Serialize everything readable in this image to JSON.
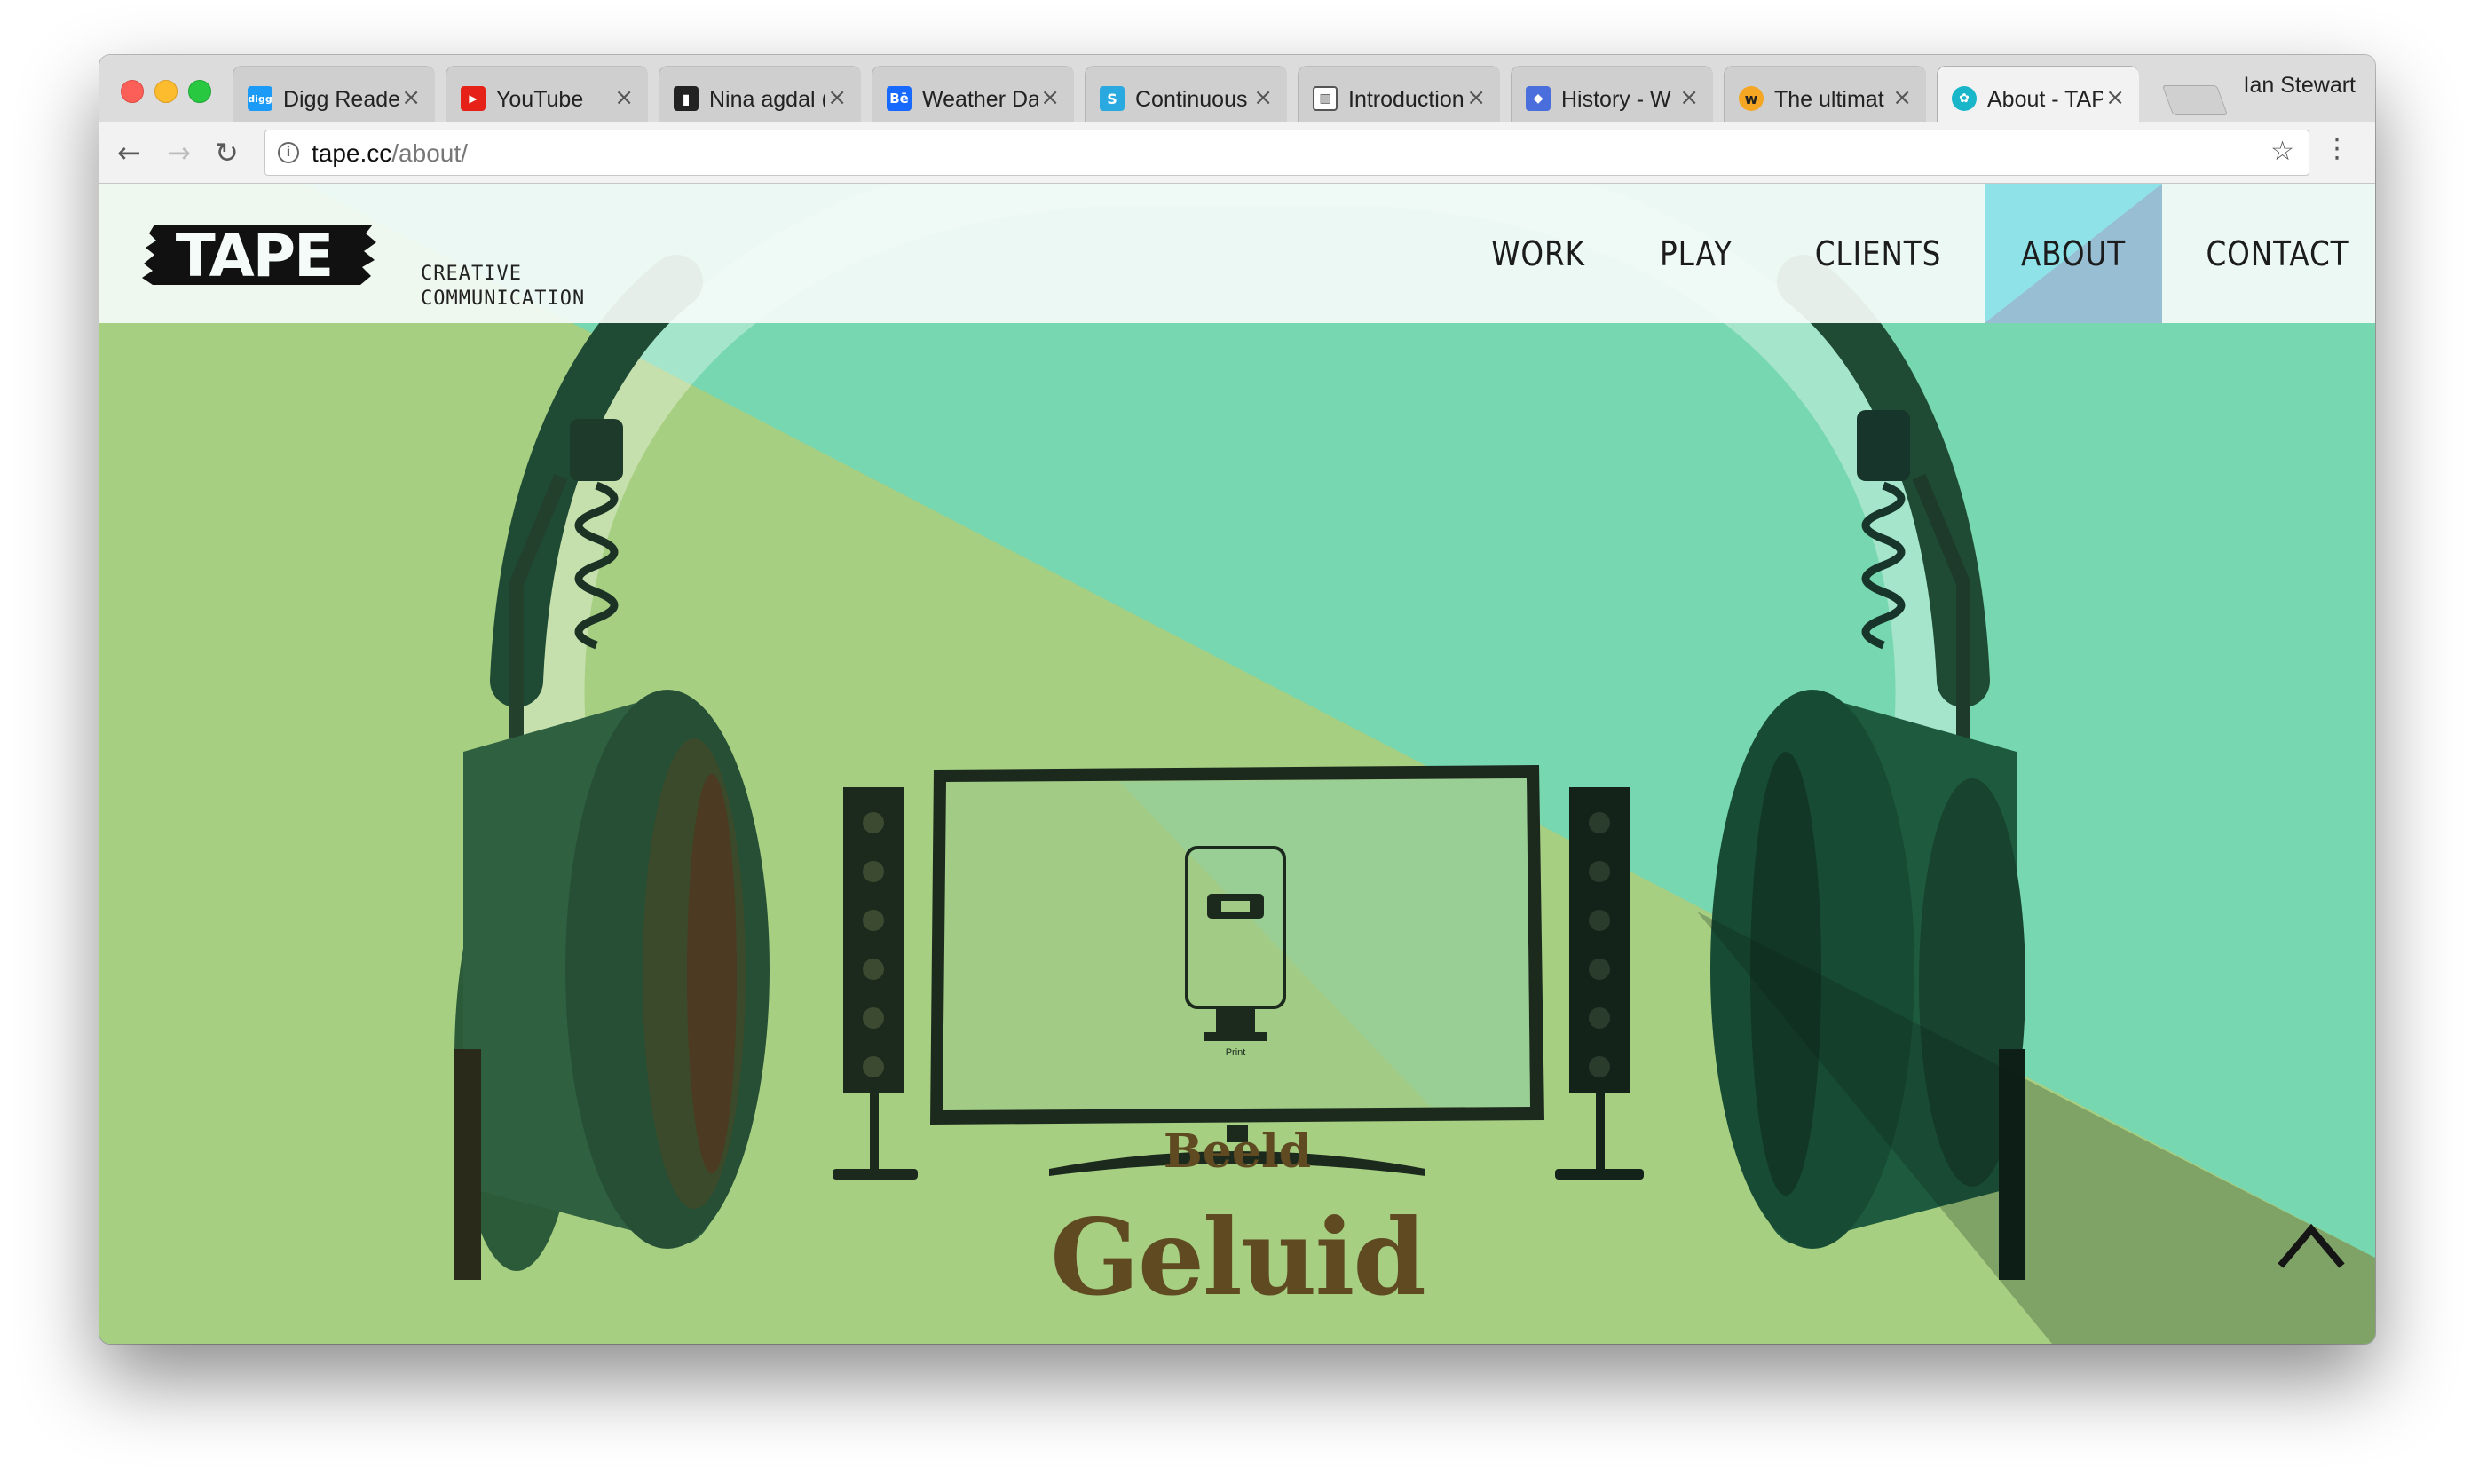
{
  "browser": {
    "tabs": [
      {
        "title": "Digg Reader",
        "favicon": "digg-icon",
        "color": "#1b9af7"
      },
      {
        "title": "YouTube",
        "favicon": "youtube-icon",
        "color": "#e62117"
      },
      {
        "title": "Nina agdal (",
        "favicon": "page-icon",
        "color": "#222222"
      },
      {
        "title": "Weather Da",
        "favicon": "behance-icon",
        "color": "#1769ff"
      },
      {
        "title": "Continuous",
        "favicon": "semaphore-icon",
        "color": "#2aa9e0"
      },
      {
        "title": "Introduction",
        "favicon": "book-icon",
        "color": "#555555"
      },
      {
        "title": "History - W",
        "favicon": "layers-icon",
        "color": "#4a6fdc"
      },
      {
        "title": "The ultimat",
        "favicon": "w-icon",
        "color": "#f5a623"
      },
      {
        "title": "About - TAP",
        "favicon": "tape-icon",
        "color": "#19b5c9"
      }
    ],
    "profile_name": "Ian Stewart",
    "url_host": "tape.cc",
    "url_path": "/about/"
  },
  "site": {
    "logo_text": "TAPE",
    "logo_sub_line1": "CREATIVE",
    "logo_sub_line2": "COMMUNICATION",
    "nav": [
      "WORK",
      "PLAY",
      "CLIENTS",
      "ABOUT",
      "CONTACT"
    ],
    "active_nav": "ABOUT",
    "hero_line1": "Beeld",
    "hero_line2": "Geluid",
    "screen_caption": "Print",
    "colors": {
      "teal": "#76d7b0",
      "green": "#a6cf82",
      "brown_text": "#5f4a22",
      "dark_green": "#1f4a34"
    }
  }
}
